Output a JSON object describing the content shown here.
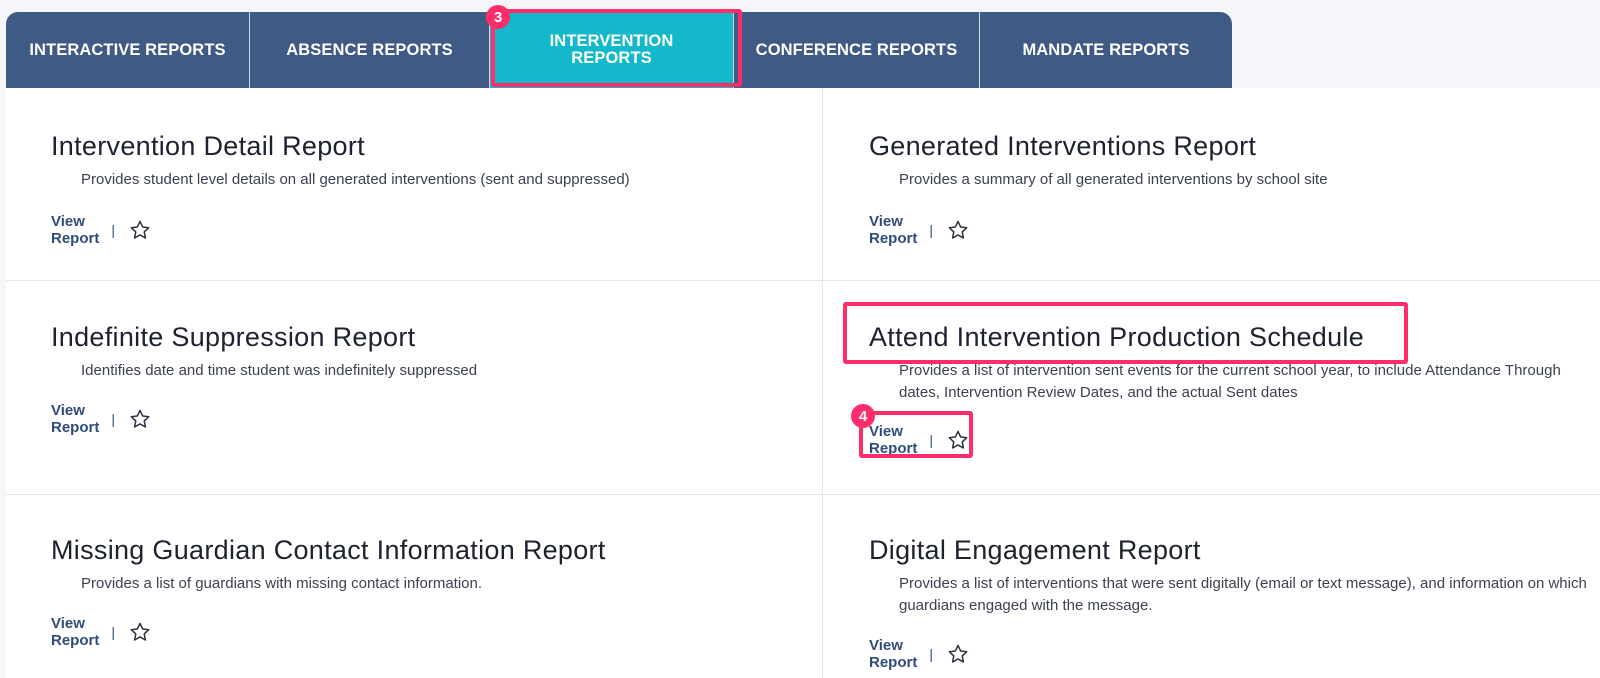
{
  "tabs": [
    {
      "label": "INTERACTIVE REPORTS"
    },
    {
      "label": "ABSENCE REPORTS"
    },
    {
      "label": "INTERVENTION REPORTS"
    },
    {
      "label": "CONFERENCE REPORTS"
    },
    {
      "label": "MANDATE REPORTS"
    }
  ],
  "active_tab": "INTERVENTION REPORTS",
  "reports": [
    {
      "title": "Intervention Detail Report",
      "description": "Provides student level details on all generated interventions (sent and suppressed)",
      "link": "View Report",
      "separator": "|",
      "icon": "star-outline-icon"
    },
    {
      "title": "Generated Interventions Report",
      "description": "Provides a summary of all generated interventions by school site",
      "link": "View Report",
      "separator": "|",
      "icon": "star-outline-icon"
    },
    {
      "title": "Indefinite Suppression Report",
      "description": "Identifies date and time student was indefinitely suppressed",
      "link": "View Report",
      "separator": "|",
      "icon": "star-outline-icon"
    },
    {
      "title": "Attend Intervention Production Schedule",
      "description": "Provides a list of intervention sent events for the current school year, to include Attendance Through dates, Intervention Review Dates, and the actual Sent dates",
      "link": "View Report",
      "separator": "|",
      "icon": "star-outline-icon"
    },
    {
      "title": "Missing Guardian Contact Information Report",
      "description": "Provides a list of guardians with missing contact information.",
      "link": "View Report",
      "separator": "|",
      "icon": "star-outline-icon"
    },
    {
      "title": "Digital Engagement Report",
      "description": "Provides a list of interventions that were sent digitally (email or text message), and information on which guardians engaged with the message.",
      "link": "View Report",
      "separator": "|",
      "icon": "star-outline-icon"
    }
  ],
  "annotations": [
    {
      "number": "3",
      "color": "#ff2e6a"
    },
    {
      "number": "4",
      "color": "#ff2e6a"
    }
  ],
  "colors": {
    "tab_bg": "#3f5a84",
    "tab_active": "#13b9cb",
    "link": "#2f4d7a",
    "highlight": "#ff2e6a"
  }
}
